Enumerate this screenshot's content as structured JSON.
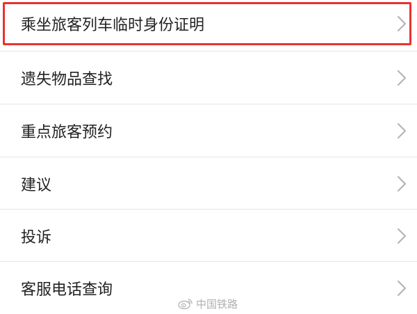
{
  "menu": {
    "items": [
      {
        "label": "乘坐旅客列车临时身份证明",
        "icon": "chevron-right-icon"
      },
      {
        "label": "遗失物品查找",
        "icon": "chevron-right-icon"
      },
      {
        "label": "重点旅客预约",
        "icon": "chevron-right-icon"
      },
      {
        "label": "建议",
        "icon": "chevron-right-icon"
      },
      {
        "label": "投诉",
        "icon": "chevron-right-icon"
      },
      {
        "label": "客服电话查询",
        "icon": "chevron-right-icon"
      }
    ]
  },
  "highlight": {
    "color": "#e8322f",
    "target_item": 0
  },
  "watermark": {
    "text": "中国铁路",
    "icon": "weibo-icon"
  },
  "colors": {
    "text": "#222222",
    "chevron": "#b5b5b5",
    "divider": "#e6e6e6",
    "watermark": "#b0b0b0"
  }
}
